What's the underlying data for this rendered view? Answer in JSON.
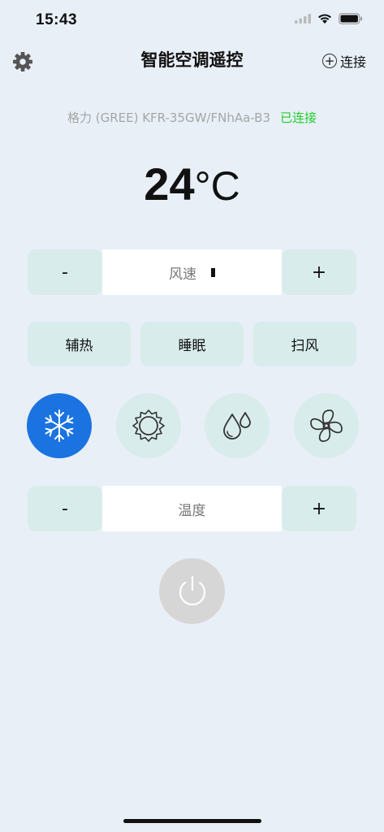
{
  "status_bar": {
    "time": "15:43"
  },
  "nav": {
    "title": "智能空调遥控",
    "connect_label": "连接",
    "connect_symbol": "+"
  },
  "device": {
    "model": "格力 (GREE) KFR-35GW/FNhAa-B3",
    "status": "已连接",
    "status_color": "#1fcf2a"
  },
  "temperature": {
    "value": "24",
    "unit": "°C"
  },
  "fan_speed": {
    "minus": "-",
    "label": "风速",
    "plus": "+"
  },
  "options": [
    {
      "label": "辅热"
    },
    {
      "label": "睡眠"
    },
    {
      "label": "扫风"
    }
  ],
  "modes": [
    {
      "icon": "snowflake-icon",
      "active": true
    },
    {
      "icon": "sun-icon",
      "active": false
    },
    {
      "icon": "water-drops-icon",
      "active": false
    },
    {
      "icon": "fan-icon",
      "active": false
    }
  ],
  "temp_control": {
    "minus": "-",
    "label": "温度",
    "plus": "+"
  },
  "colors": {
    "background": "#e8eff7",
    "button": "#d8eceb",
    "accent": "#1a73e0",
    "power": "#d6d6d6"
  }
}
